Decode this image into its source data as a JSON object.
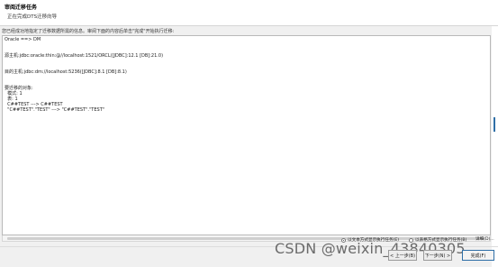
{
  "header": {
    "title": "审阅迁移任务",
    "subtitle": "正在完成DTS迁移向导"
  },
  "instruction": "您已经成功地指定了迁移数据所需的信息。审阅下面的内容后单击\"完成\"开始执行迁移:",
  "summary": {
    "lines": [
      "Oracle ==> DM",
      "",
      "",
      "源主机:jdbc:oracle:thin:@//localhost:1521/ORCL([JDBC]:12.1 [DB]:21.0)",
      "",
      "",
      "目的主机:jdbc:dm://localhost:5236([JDBC]:8.1 [DB]:8.1)",
      "",
      "",
      "要迁移的对象:",
      "  模式: 1",
      "  表: 1",
      "  C##TEST ---> C##TEST",
      "  \"C##TEST\".\"TEST\" ---> \"C##TEST\".\"TEST\""
    ]
  },
  "options": {
    "text_mode_label": "以文本方式显示执行任务(E)",
    "table_mode_label": "以表格方式显示执行任务(B)",
    "detail_label": "详细(D)..."
  },
  "buttons": {
    "prev_label": "< 上一步(B)",
    "next_label": "下一步(N) >",
    "finish_label": "完成(F)"
  },
  "watermark": "CSDN @weixin_43840305",
  "colors": {
    "finish_border": "#2f6fa7",
    "header_bg": "#ffffff",
    "panel_bg": "#f0f0f0"
  }
}
